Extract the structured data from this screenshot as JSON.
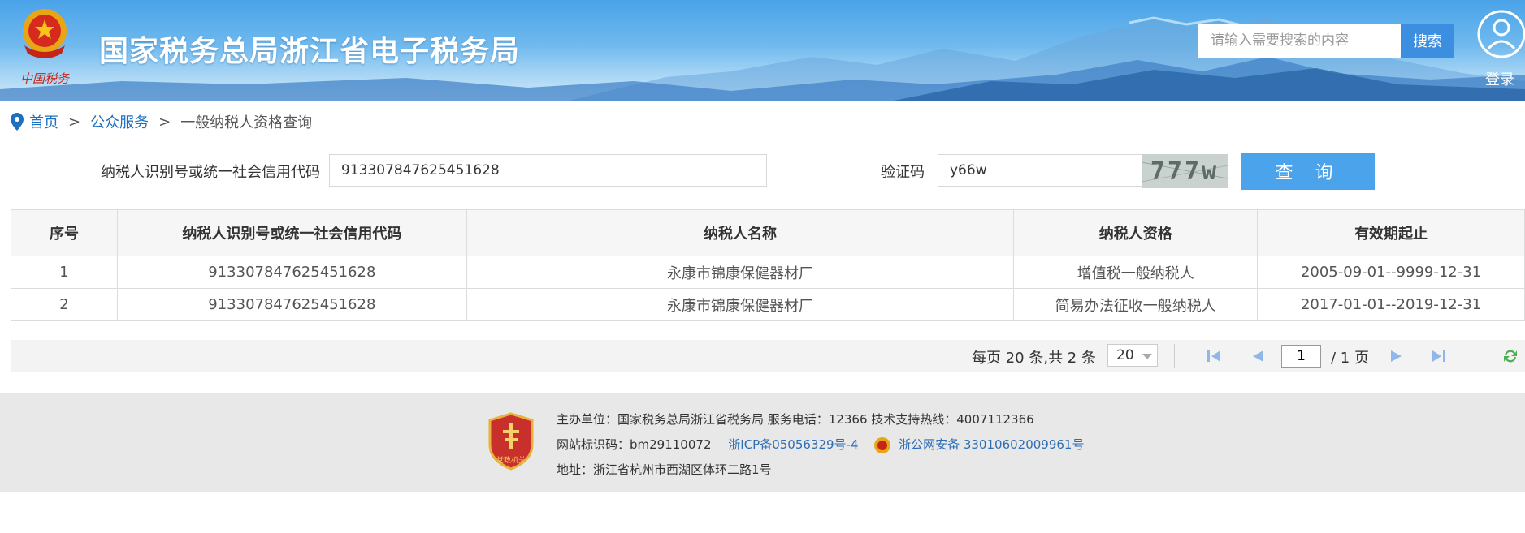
{
  "header": {
    "site_title": "国家税务总局浙江省电子税务局",
    "search_placeholder": "请输入需要搜索的内容",
    "search_button": "搜索",
    "login_label": "登录",
    "emblem_script": "中国税务"
  },
  "breadcrumb": {
    "home": "首页",
    "sep1": ">",
    "public_services": "公众服务",
    "sep2": ">",
    "current": "一般纳税人资格查询"
  },
  "form": {
    "taxpayer_id_label": "纳税人识别号或统一社会信用代码",
    "taxpayer_id_value": "913307847625451628",
    "captcha_label": "验证码",
    "captcha_value": "y66w",
    "captcha_image_text": "777w",
    "query_button": "查 询"
  },
  "table": {
    "headers": [
      "序号",
      "纳税人识别号或统一社会信用代码",
      "纳税人名称",
      "纳税人资格",
      "有效期起止"
    ],
    "rows": [
      [
        "1",
        "913307847625451628",
        "永康市锦康保健器材厂",
        "增值税一般纳税人",
        "2005-09-01--9999-12-31"
      ],
      [
        "2",
        "913307847625451628",
        "永康市锦康保健器材厂",
        "简易办法征收一般纳税人",
        "2017-01-01--2019-12-31"
      ]
    ]
  },
  "pager": {
    "summary": "每页 20 条,共 2 条",
    "page_size": "20",
    "current_page": "1",
    "total_pages": "/ 1 页"
  },
  "footer": {
    "line1": "主办单位：国家税务总局浙江省税务局    服务电话：12366    技术支持热线：4007112366",
    "site_id": "网站标识码：bm29110072",
    "icp": "浙ICP备05056329号-4",
    "police": "浙公网安备 33010602009961号",
    "address": "地址：浙江省杭州市西湖区体环二路1号",
    "badge_text": "党政机关"
  },
  "colors": {
    "header_blue": "#4aa3e8",
    "link_blue": "#1e6fc0",
    "query_button": "#4ba3ec",
    "search_button": "#3c8ee0",
    "footer_bg": "#e8e8e8"
  }
}
